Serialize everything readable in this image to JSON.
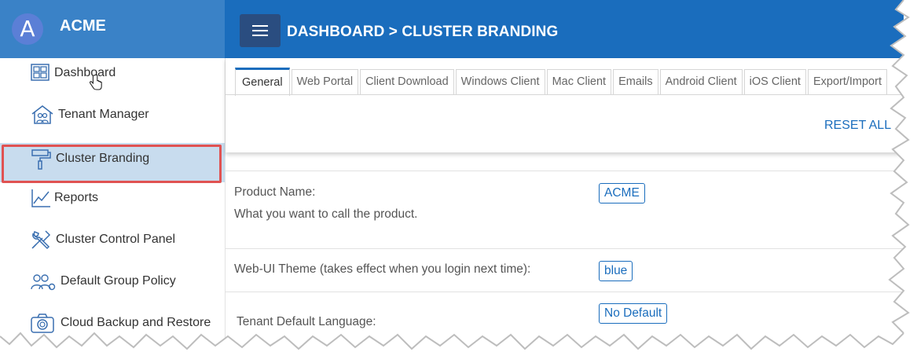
{
  "brand": {
    "logo_letter": "A",
    "name": "ACME"
  },
  "header": {
    "breadcrumb": "DASHBOARD > CLUSTER BRANDING"
  },
  "sidebar": {
    "items": [
      {
        "label": "Dashboard",
        "icon": "grid-icon"
      },
      {
        "label": "Tenant Manager",
        "icon": "house-users-icon"
      },
      {
        "label": "Cluster Branding",
        "icon": "paint-roller-icon",
        "active": true
      },
      {
        "label": "Reports",
        "icon": "chart-line-icon"
      },
      {
        "label": "Cluster Control Panel",
        "icon": "tools-icon"
      },
      {
        "label": "Default Group Policy",
        "icon": "users-gear-icon"
      },
      {
        "label": "Cloud Backup and Restore",
        "icon": "camera-icon"
      }
    ]
  },
  "tabs": [
    "General",
    "Web Portal",
    "Client Download",
    "Windows Client",
    "Mac Client",
    "Emails",
    "Android Client",
    "iOS Client",
    "Export/Import"
  ],
  "actions": {
    "reset_all": "RESET ALL"
  },
  "settings": {
    "product_name": {
      "label": "Product Name:",
      "description": "What you want to call the product.",
      "value": "ACME"
    },
    "theme": {
      "label": "Web-UI Theme (takes effect when you login next time):",
      "value": "blue"
    },
    "language": {
      "label": "Tenant Default Language:",
      "value": "No Default"
    }
  },
  "colors": {
    "header": "#1a6dbd",
    "brand": "#3a82c7",
    "active_item": "#c8dcee",
    "highlight": "#e05252"
  }
}
